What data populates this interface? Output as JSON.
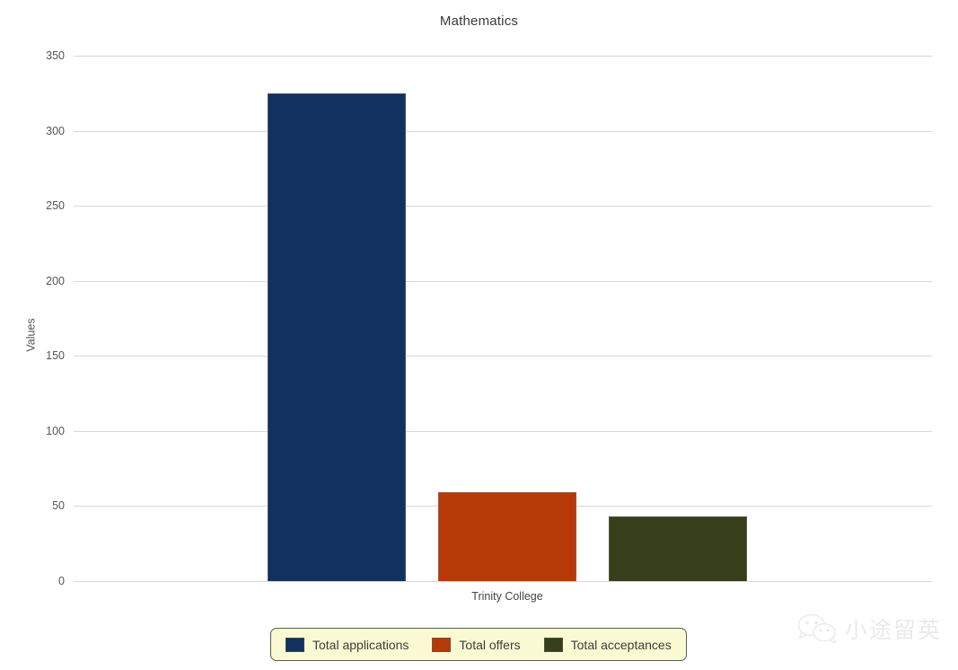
{
  "chart_data": {
    "type": "bar",
    "title": "Mathematics",
    "xlabel": "",
    "ylabel": "Values",
    "categories": [
      "Trinity College"
    ],
    "series": [
      {
        "name": "Total applications",
        "values": [
          325
        ],
        "color": "#12315e"
      },
      {
        "name": "Total offers",
        "values": [
          59
        ],
        "color": "#b63a08"
      },
      {
        "name": "Total acceptances",
        "values": [
          43
        ],
        "color": "#363f1a"
      }
    ],
    "ylim": [
      0,
      350
    ],
    "yticks": [
      0,
      50,
      100,
      150,
      200,
      250,
      300,
      350
    ],
    "ytick_labels": [
      "0",
      "50",
      "100",
      "150",
      "200",
      "250",
      "300",
      "350"
    ],
    "grid": true,
    "legend_position": "bottom-center"
  },
  "legend": {
    "items": [
      {
        "label": "Total applications",
        "color": "#12315e"
      },
      {
        "label": "Total offers",
        "color": "#b63a08"
      },
      {
        "label": "Total acceptances",
        "color": "#363f1a"
      }
    ],
    "background": "#fafad2",
    "border_color": "#5a5a5a"
  },
  "watermark": {
    "text": "小途留英",
    "icon": "wechat-icon",
    "color": "#d9d9d9"
  }
}
